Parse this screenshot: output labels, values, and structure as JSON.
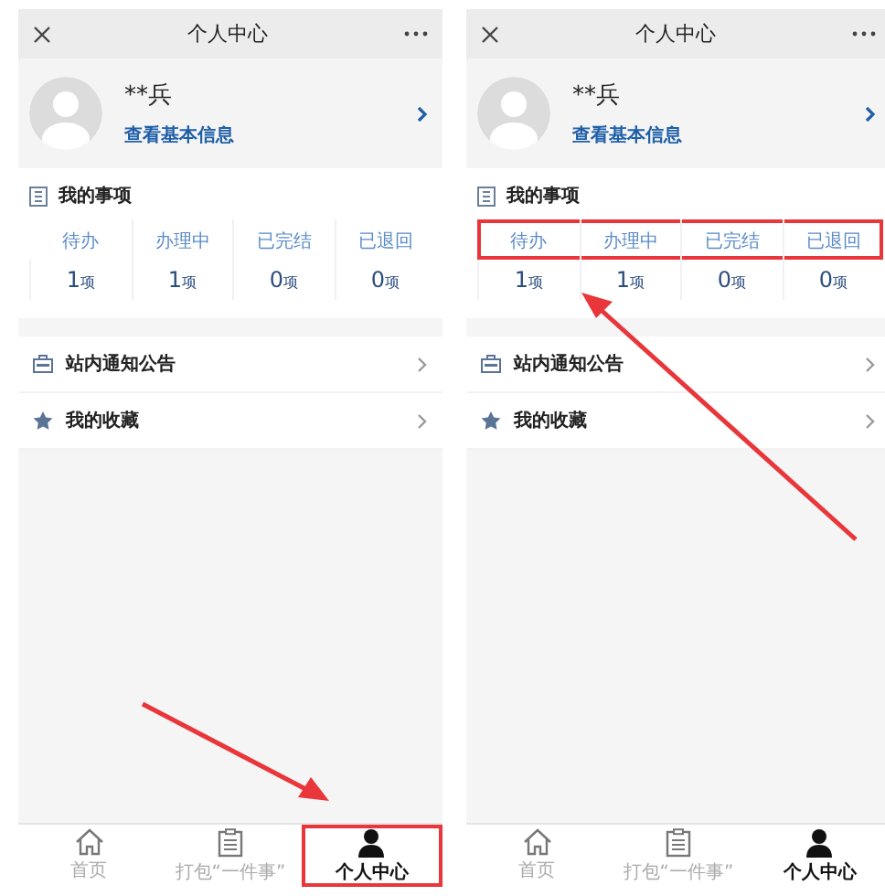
{
  "screens": [
    {
      "title": "个人中心",
      "profile": {
        "name": "**兵",
        "link": "查看基本信息"
      },
      "matters": {
        "heading": "我的事项",
        "labels_highlighted": false,
        "items": [
          {
            "label": "待办",
            "count": "1",
            "unit": "项"
          },
          {
            "label": "办理中",
            "count": "1",
            "unit": "项"
          },
          {
            "label": "已完结",
            "count": "0",
            "unit": "项"
          },
          {
            "label": "已退回",
            "count": "0",
            "unit": "项"
          }
        ]
      },
      "menu": [
        {
          "kind": "notice",
          "label": "站内通知公告"
        },
        {
          "kind": "star",
          "label": "我的收藏"
        }
      ],
      "tabs": [
        {
          "kind": "home",
          "label": "首页",
          "selected": false,
          "highlighted": false
        },
        {
          "kind": "clipboard",
          "label": "打包“一件事”",
          "selected": false,
          "highlighted": false
        },
        {
          "kind": "person",
          "label": "个人中心",
          "selected": true,
          "highlighted": true
        }
      ]
    },
    {
      "title": "个人中心",
      "profile": {
        "name": "**兵",
        "link": "查看基本信息"
      },
      "matters": {
        "heading": "我的事项",
        "labels_highlighted": true,
        "items": [
          {
            "label": "待办",
            "count": "1",
            "unit": "项"
          },
          {
            "label": "办理中",
            "count": "1",
            "unit": "项"
          },
          {
            "label": "已完结",
            "count": "0",
            "unit": "项"
          },
          {
            "label": "已退回",
            "count": "0",
            "unit": "项"
          }
        ]
      },
      "menu": [
        {
          "kind": "notice",
          "label": "站内通知公告"
        },
        {
          "kind": "star",
          "label": "我的收藏"
        }
      ],
      "tabs": [
        {
          "kind": "home",
          "label": "首页",
          "selected": false,
          "highlighted": false
        },
        {
          "kind": "clipboard",
          "label": "打包“一件事”",
          "selected": false,
          "highlighted": false
        },
        {
          "kind": "person",
          "label": "个人中心",
          "selected": true,
          "highlighted": false
        }
      ]
    }
  ]
}
